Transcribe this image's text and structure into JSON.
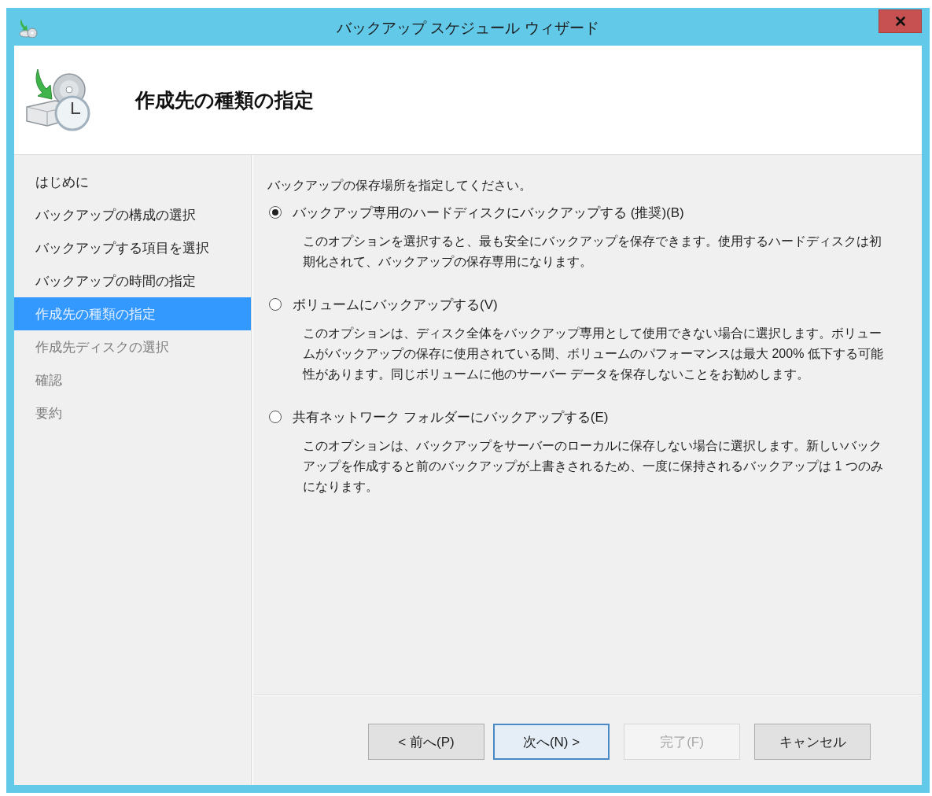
{
  "window": {
    "title": "バックアップ スケジュール ウィザード"
  },
  "header": {
    "title": "作成先の種類の指定"
  },
  "steps": [
    {
      "label": "はじめに",
      "selected": false,
      "disabled": false
    },
    {
      "label": "バックアップの構成の選択",
      "selected": false,
      "disabled": false
    },
    {
      "label": "バックアップする項目を選択",
      "selected": false,
      "disabled": false
    },
    {
      "label": "バックアップの時間の指定",
      "selected": false,
      "disabled": false
    },
    {
      "label": "作成先の種類の指定",
      "selected": true,
      "disabled": false
    },
    {
      "label": "作成先ディスクの選択",
      "selected": false,
      "disabled": true
    },
    {
      "label": "確認",
      "selected": false,
      "disabled": true
    },
    {
      "label": "要約",
      "selected": false,
      "disabled": true
    }
  ],
  "content": {
    "prompt": "バックアップの保存場所を指定してください。",
    "options": [
      {
        "label": "バックアップ専用のハードディスクにバックアップする (推奨)(B)",
        "description": "このオプションを選択すると、最も安全にバックアップを保存できます。使用するハードディスクは初期化されて、バックアップの保存専用になります。",
        "selected": true
      },
      {
        "label": "ボリュームにバックアップする(V)",
        "description": "このオプションは、ディスク全体をバックアップ専用として使用できない場合に選択します。ボリュームがバックアップの保存に使用されている間、ボリュームのパフォーマンスは最大 200% 低下する可能性があります。同じボリュームに他のサーバー データを保存しないことをお勧めします。",
        "selected": false
      },
      {
        "label": "共有ネットワーク フォルダーにバックアップする(E)",
        "description": "このオプションは、バックアップをサーバーのローカルに保存しない場合に選択します。新しいバックアップを作成すると前のバックアップが上書きされるため、一度に保持されるバックアップは 1 つのみになります。",
        "selected": false
      }
    ]
  },
  "buttons": [
    {
      "label": "< 前へ(P)",
      "focused": false,
      "disabled": false
    },
    {
      "label": "次へ(N) >",
      "focused": true,
      "disabled": false
    },
    {
      "label": "完了(F)",
      "focused": false,
      "disabled": true
    },
    {
      "label": "キャンセル",
      "focused": false,
      "disabled": false
    }
  ]
}
